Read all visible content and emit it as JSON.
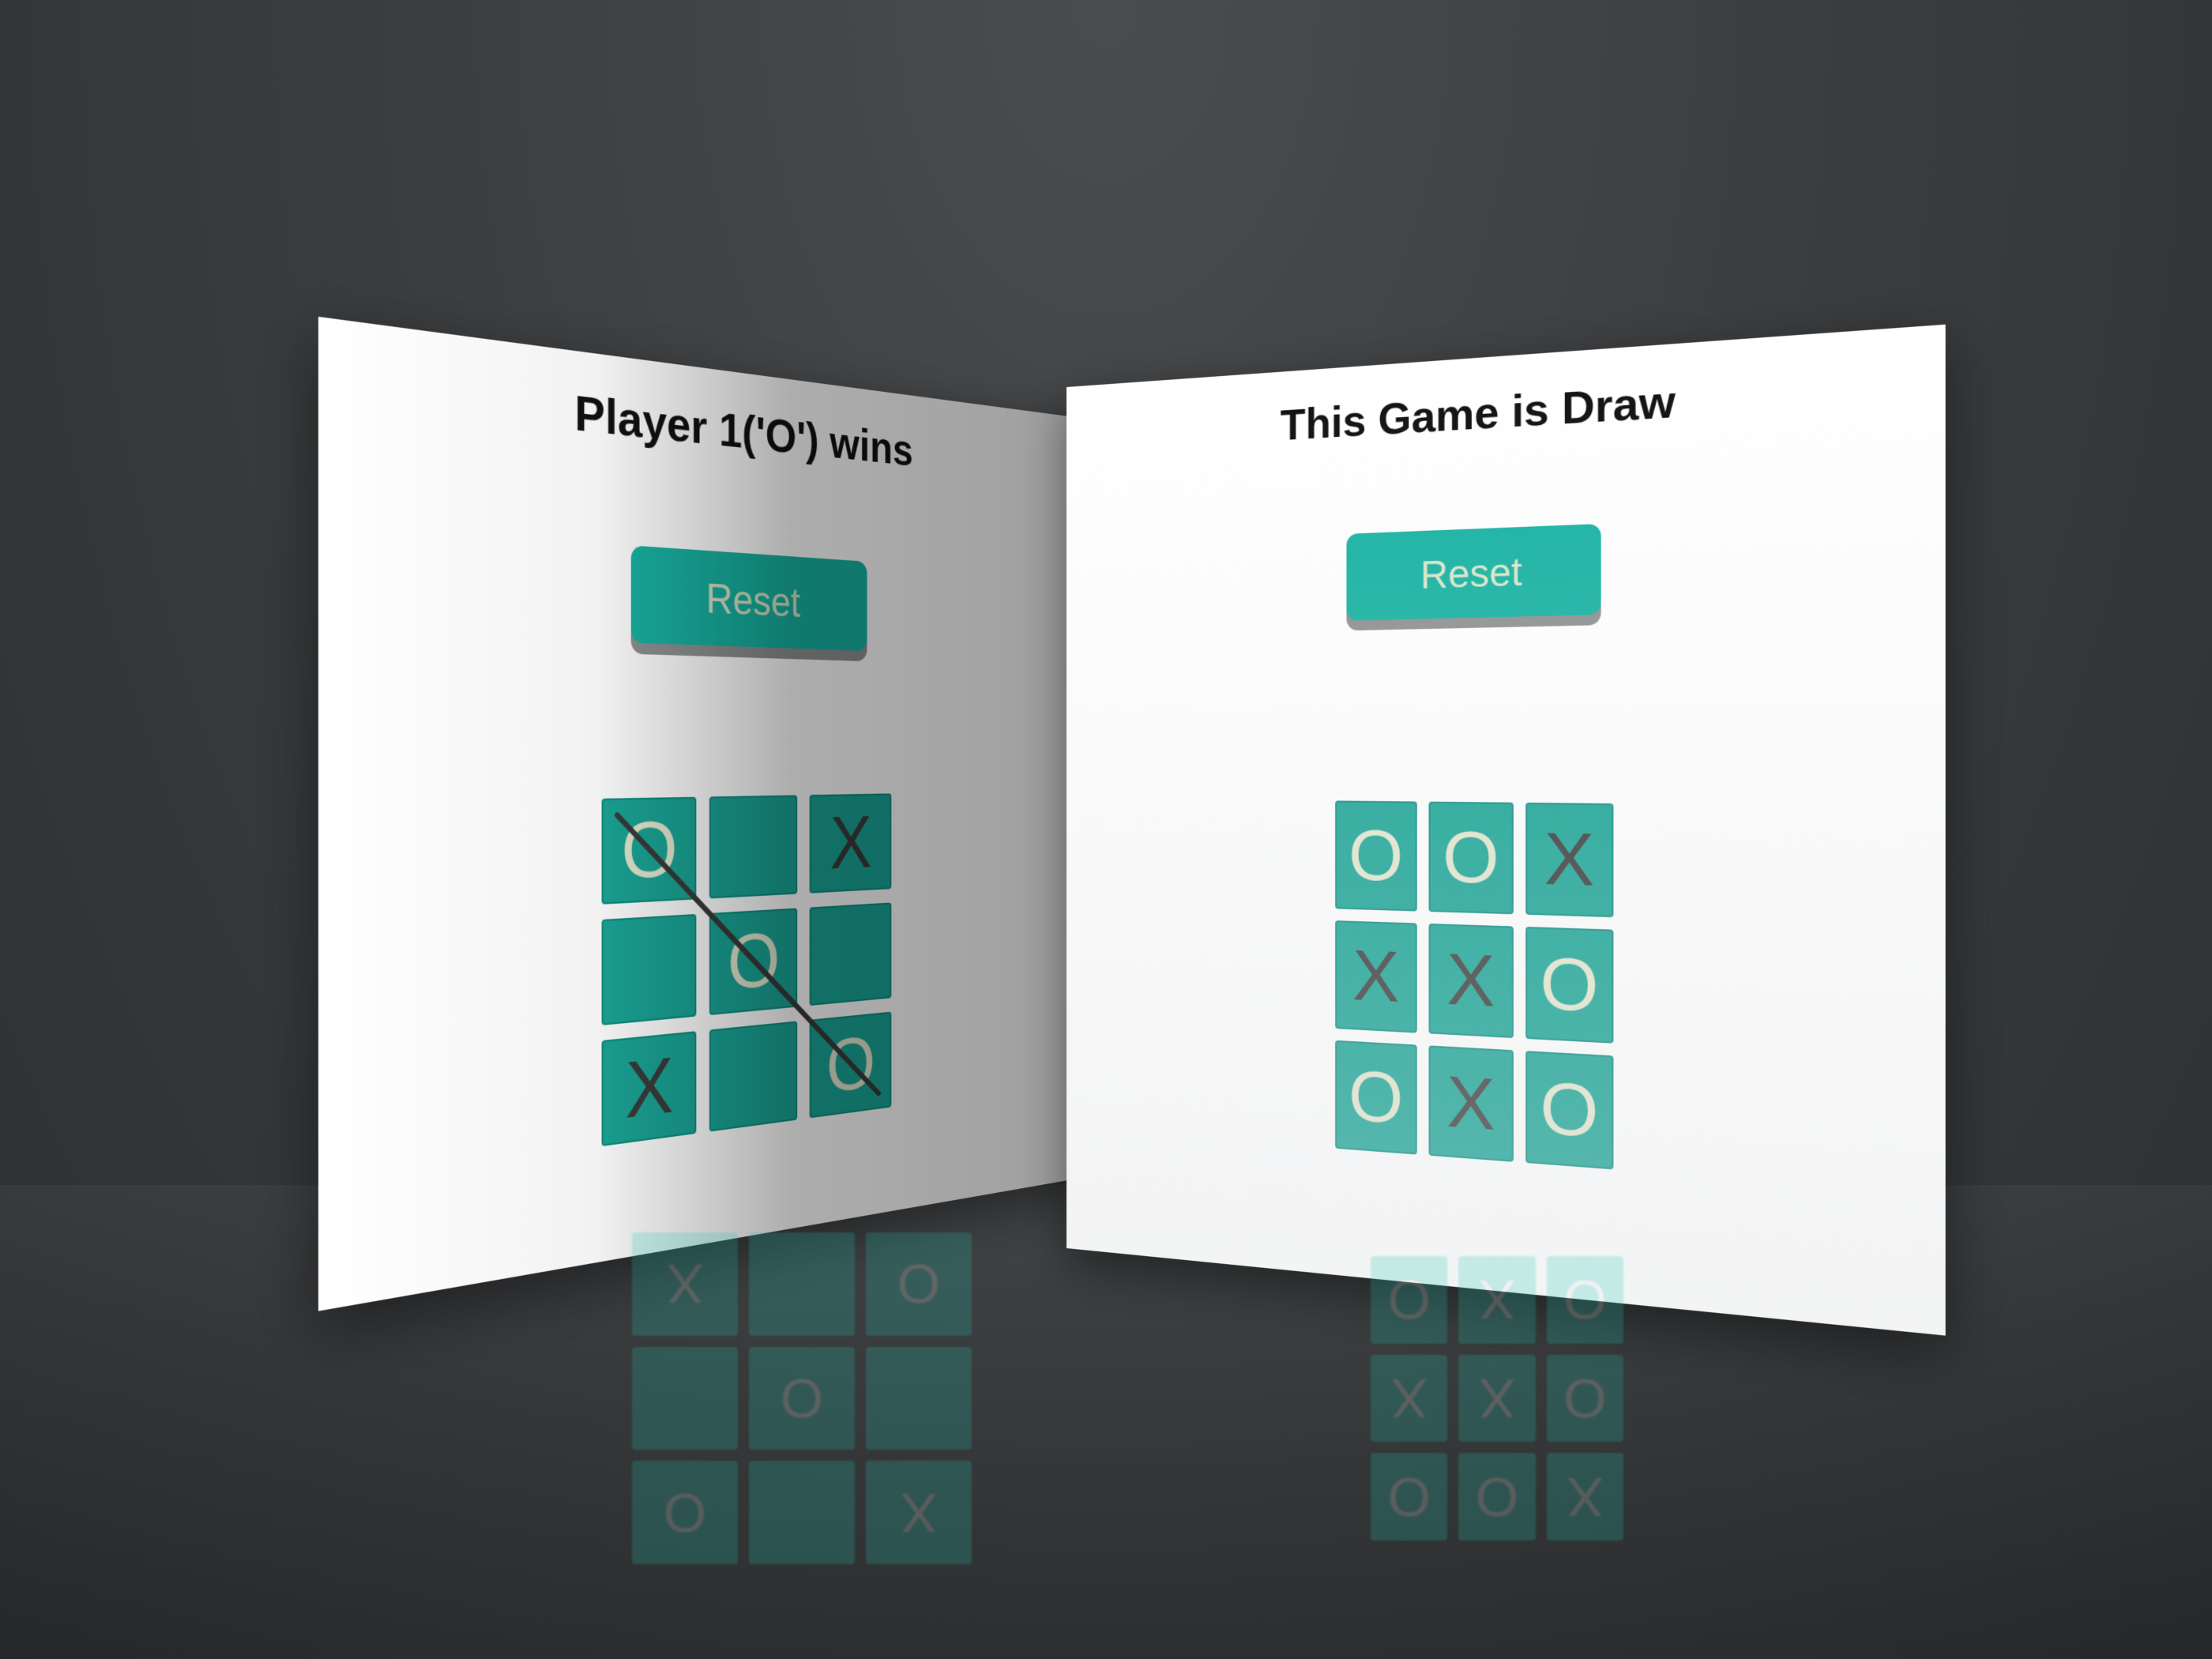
{
  "left_game": {
    "status": "Player 1('O') wins",
    "reset_label": "Reset",
    "cells": [
      "O",
      "",
      "X",
      "",
      "O",
      "",
      "X",
      "",
      "O"
    ]
  },
  "right_game": {
    "status": "This Game is Draw",
    "reset_label": "Reset",
    "cells": [
      "O",
      "O",
      "X",
      "X",
      "X",
      "O",
      "O",
      "X",
      "O"
    ]
  },
  "colors": {
    "tile": "#1aa596",
    "button": "#18b3a3",
    "o_mark": "#e4e8cf",
    "x_mark": "#3b3b3b"
  }
}
